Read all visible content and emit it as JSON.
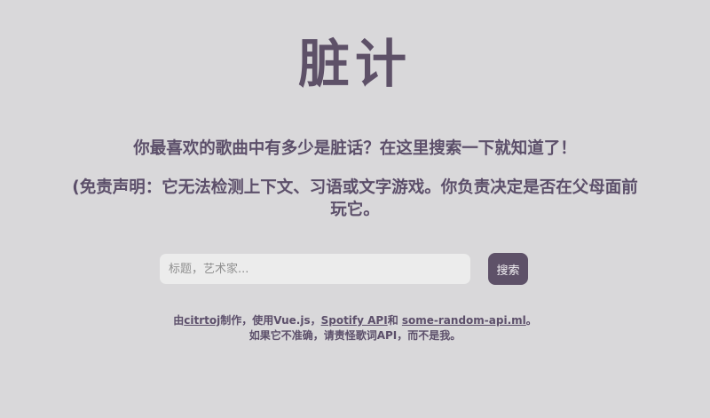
{
  "header": {
    "title": "脏计"
  },
  "intro": {
    "subtitle": "你最喜欢的歌曲中有多少是脏话？在这里搜索一下就知道了！",
    "disclaimer": "(免责声明：它无法检测上下文、习语或文字游戏。你负责决定是否在父母面前玩它。"
  },
  "search": {
    "placeholder": "标题，艺术家...",
    "value": "",
    "button_label": "搜索"
  },
  "footer": {
    "made_by_prefix": "由",
    "author_link": "citrtoj",
    "made_by_suffix": "制作，使用Vue.js，",
    "spotify_link": "Spotify API",
    "and_text": "和 ",
    "api_link": "some-random-api.ml",
    "end_period": "。",
    "line2": "如果它不准确，请责怪歌词API，而不是我。"
  },
  "colors": {
    "background": "#d9d8da",
    "accent": "#5e5168",
    "input_bg": "#ececec"
  }
}
